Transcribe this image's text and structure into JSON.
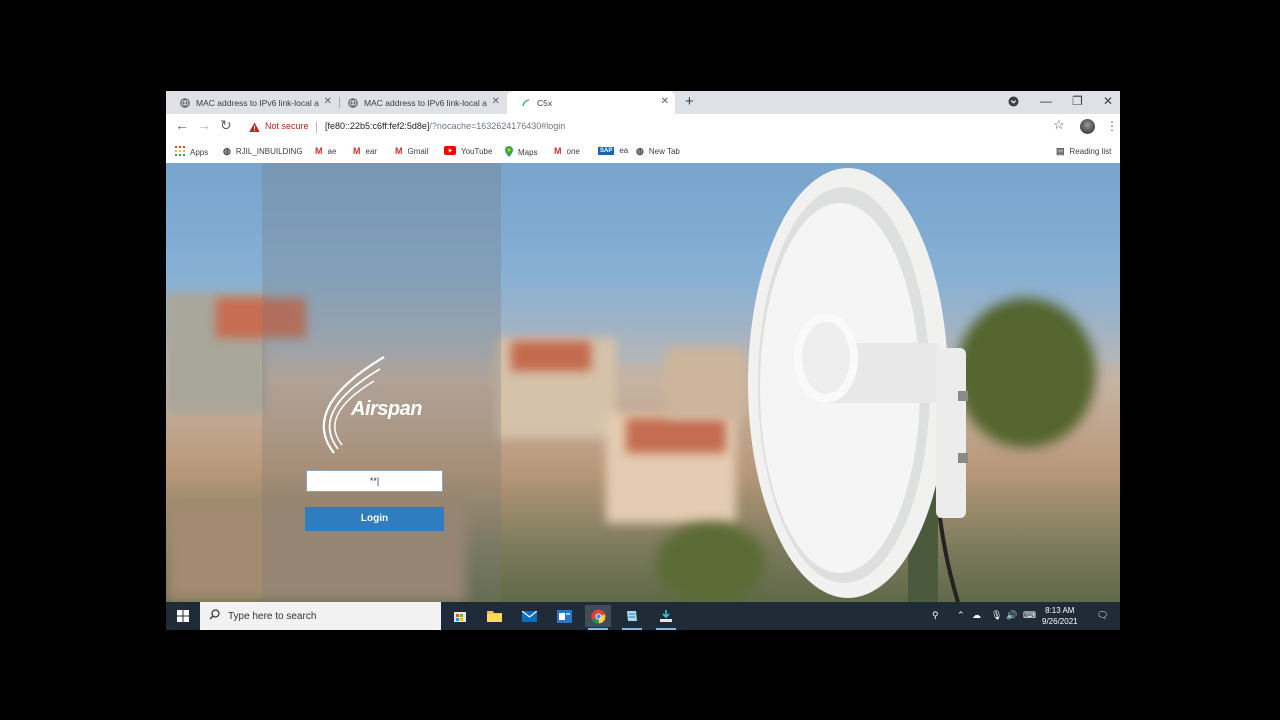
{
  "browser": {
    "tabs": [
      {
        "title": "MAC address to IPv6 link-local a",
        "active": false
      },
      {
        "title": "MAC address to IPv6 link-local a",
        "active": false
      },
      {
        "title": "C5x",
        "active": true
      }
    ],
    "security_label": "Not secure",
    "url_host": "[fe80::22b5:c6ff:fef2:5d8e]",
    "url_rest": "/?nocache=1632624176430#login",
    "bookmarks": [
      "Apps",
      "RJIL_INBUILDING",
      "ae",
      "ear",
      "Gmail",
      "YouTube",
      "Maps",
      "one",
      "ea",
      "New Tab"
    ],
    "reading_list": "Reading list"
  },
  "page": {
    "brand": "Airspan",
    "password_value": "**|",
    "login_label": "Login"
  },
  "taskbar": {
    "search_placeholder": "Type here to search",
    "time": "8:13 AM",
    "date": "9/26/2021"
  }
}
